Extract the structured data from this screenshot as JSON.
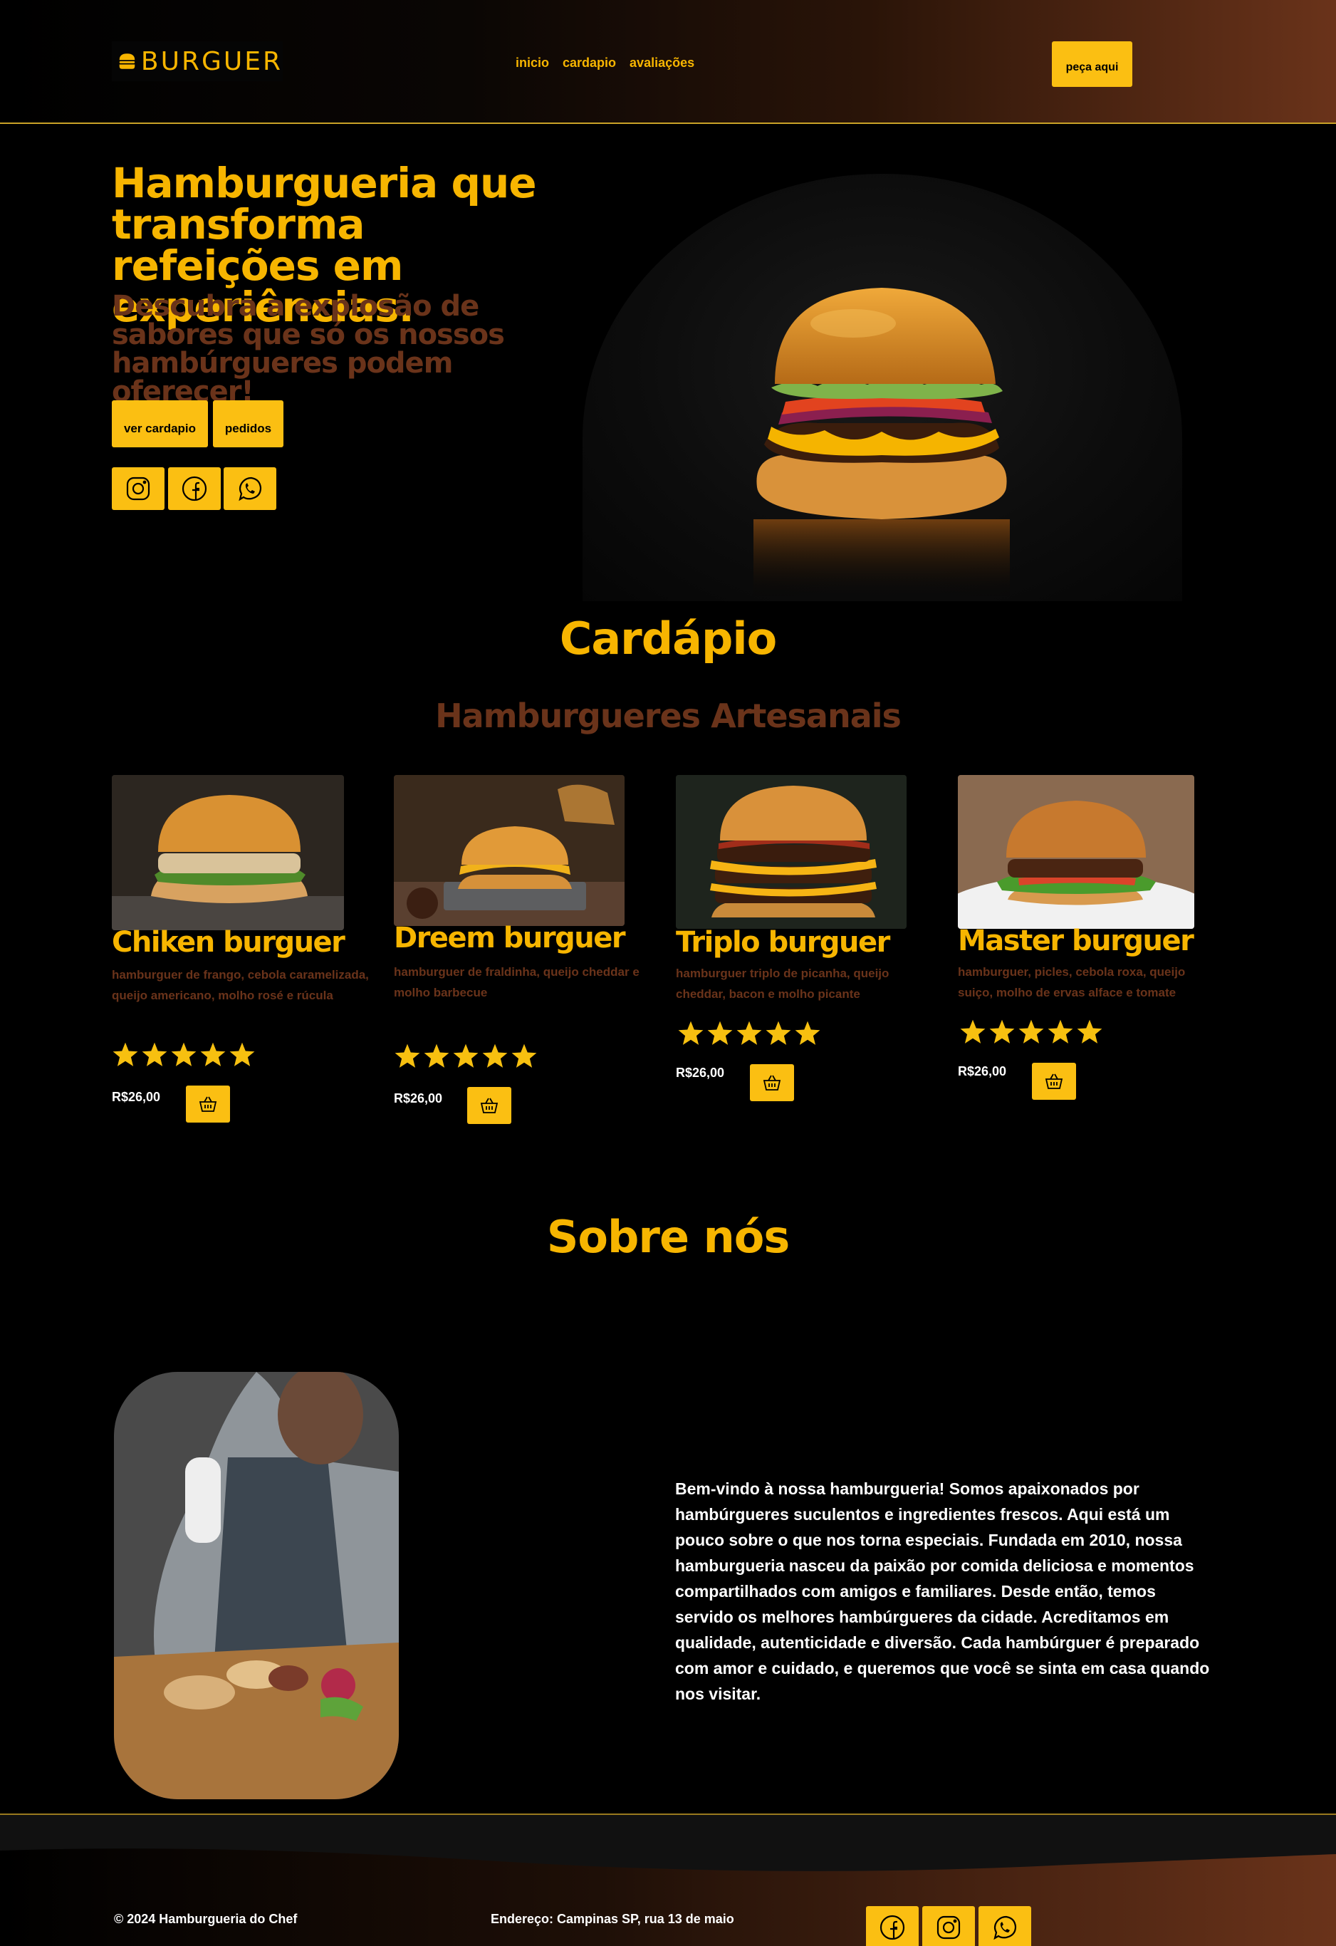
{
  "header": {
    "logo_text": "BURGUER",
    "nav": [
      "inicio",
      "cardapio",
      "avaliações"
    ],
    "order_button": "peça aqui"
  },
  "hero": {
    "title": "Hamburgueria que transforma refeições em experiências.",
    "subtitle": "Descubra a explosão de sabores que só os nossos hambúrgueres podem oferecer!",
    "buttons": [
      "ver cardapio",
      "pedidos"
    ],
    "social_icons": [
      "instagram-icon",
      "facebook-icon",
      "whatsapp-icon"
    ]
  },
  "menu": {
    "title": "Cardápio",
    "subtitle": "Hamburgueres Artesanais",
    "items": [
      {
        "name": "Chiken burguer",
        "description": "hamburguer de frango, cebola caramelizada, queijo americano, molho rosé e rúcula",
        "rating": 5,
        "price": "R$26,00"
      },
      {
        "name": "Dreem burguer",
        "description": "hamburguer de fraldinha, queijo cheddar e molho barbecue",
        "rating": 5,
        "price": "R$26,00"
      },
      {
        "name": "Triplo burguer",
        "description": "hamburguer triplo de picanha, queijo cheddar, bacon e molho picante",
        "rating": 5,
        "price": "R$26,00"
      },
      {
        "name": "Master burguer",
        "description": "hamburguer, picles, cebola roxa, queijo suiço, molho de ervas alface e tomate",
        "rating": 5,
        "price": "R$26,00"
      }
    ]
  },
  "about": {
    "title": "Sobre nós",
    "text": "Bem-vindo à nossa hamburgueria! Somos apaixonados por hambúrgueres suculentos e ingredientes frescos. Aqui está um pouco sobre o que nos torna especiais. Fundada em 2010, nossa hamburgueria nasceu da paixão por comida deliciosa e momentos compartilhados com amigos e familiares. Desde então, temos servido os melhores hambúrgueres da cidade. Acreditamos em qualidade, autenticidade e diversão. Cada hambúrguer é preparado com amor e cuidado, e queremos que você se sinta em casa quando nos visitar."
  },
  "footer": {
    "copyright": "© 2024 Hamburgueria do Chef",
    "address": "Endereço: Campinas SP, rua 13 de maio",
    "social_icons": [
      "facebook-icon",
      "instagram-icon",
      "whatsapp-icon"
    ]
  },
  "colors": {
    "accent": "#fbbf12",
    "brand_yellow": "#f7b500",
    "brown": "#6a331a",
    "background": "#000000"
  }
}
